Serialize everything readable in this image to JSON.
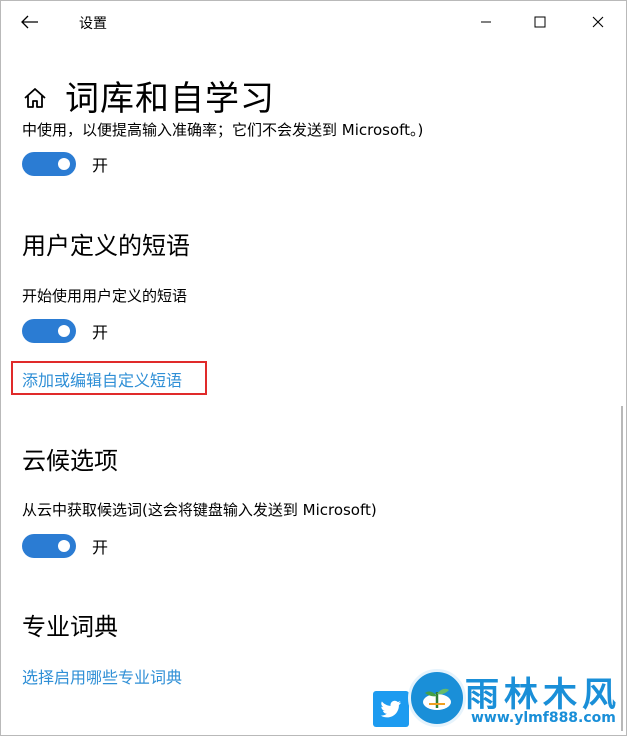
{
  "window": {
    "title": "设置"
  },
  "page": {
    "title": "词库和自学习",
    "description": "中使用，以便提高输入准确率；它们不会发送到 Microsoft。)"
  },
  "toggles": {
    "self_learning": {
      "label": "开",
      "on": true
    },
    "user_phrases": {
      "label": "开",
      "on": true
    },
    "cloud_candidates": {
      "label": "开",
      "on": true
    }
  },
  "sections": {
    "user_phrases": {
      "heading": "用户定义的短语",
      "setting_label": "开始使用用户定义的短语",
      "link": "添加或编辑自定义短语"
    },
    "cloud": {
      "heading": "云候选项",
      "setting_label": "从云中获取候选词(这会将键盘输入发送到 Microsoft)"
    },
    "dictionary": {
      "heading": "专业词典",
      "link": "选择启用哪些专业词典"
    }
  },
  "watermark": {
    "brand": "雨林木风",
    "url": "www.ylmf888.com"
  },
  "colors": {
    "accent": "#2b7cd3",
    "link": "#2f8fd6",
    "highlight": "#e02a2a",
    "watermark": "#1a8fd8"
  },
  "icons": {
    "back": "back-arrow-icon",
    "home": "home-icon",
    "minimize": "minimize-icon",
    "maximize": "maximize-icon",
    "close": "close-icon"
  }
}
